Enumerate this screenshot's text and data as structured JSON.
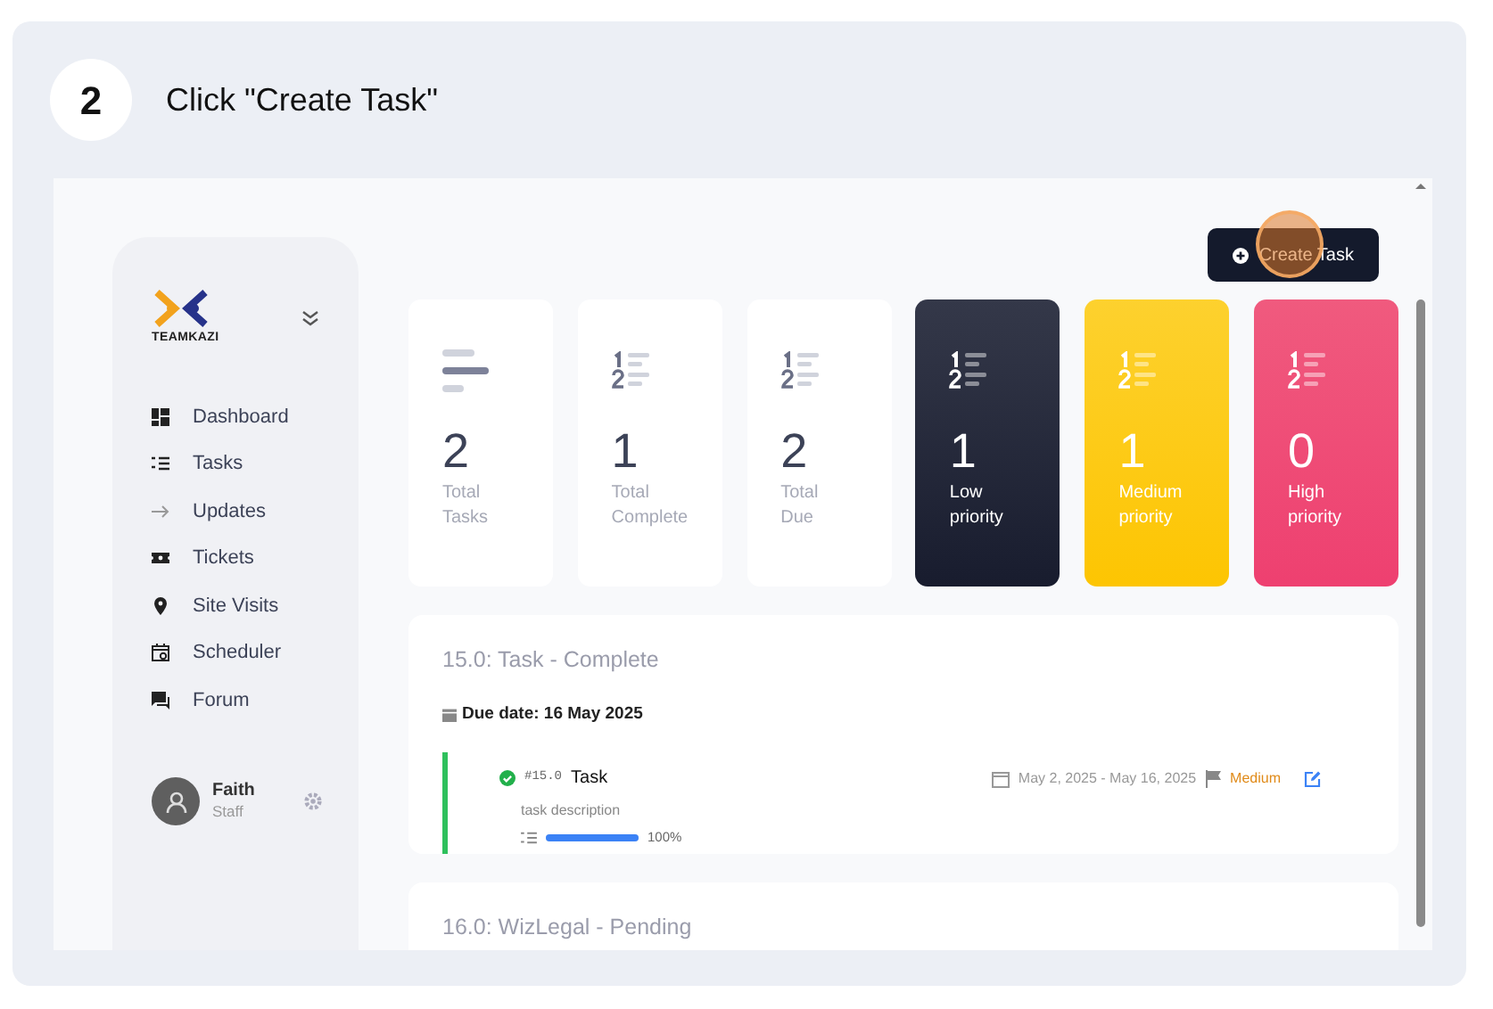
{
  "step": {
    "number": "2",
    "instruction": "Click \"Create Task\""
  },
  "sidebar": {
    "logo": "TEAMKAZI",
    "items": [
      {
        "label": "Dashboard"
      },
      {
        "label": "Tasks"
      },
      {
        "label": "Updates"
      },
      {
        "label": "Tickets"
      },
      {
        "label": "Site Visits"
      },
      {
        "label": "Scheduler"
      },
      {
        "label": "Forum"
      }
    ],
    "user": {
      "name": "Faith",
      "role": "Staff"
    }
  },
  "create_button": {
    "label": "Create Task"
  },
  "stats": [
    {
      "kind": "summary",
      "value": "2",
      "label": "Total Tasks"
    },
    {
      "kind": "count",
      "value": "1",
      "label": "Total Complete"
    },
    {
      "kind": "count",
      "value": "2",
      "label": "Total Due"
    },
    {
      "kind": "low",
      "value": "1",
      "label": "Low priority"
    },
    {
      "kind": "medium",
      "value": "1",
      "label": "Medium priority"
    },
    {
      "kind": "high",
      "value": "0",
      "label": "High priority"
    }
  ],
  "groups": [
    {
      "title": "15.0: Task - Complete",
      "due": "Due date: 16 May 2025",
      "tasks": [
        {
          "code": "#15.0",
          "name": "Task",
          "description": "task description",
          "level": 1,
          "progress": "100%",
          "dates": "May 2, 2025 - May 16, 2025",
          "priority": "Medium",
          "done": true
        }
      ]
    },
    {
      "title": "16.0: WizLegal - Pending"
    }
  ]
}
